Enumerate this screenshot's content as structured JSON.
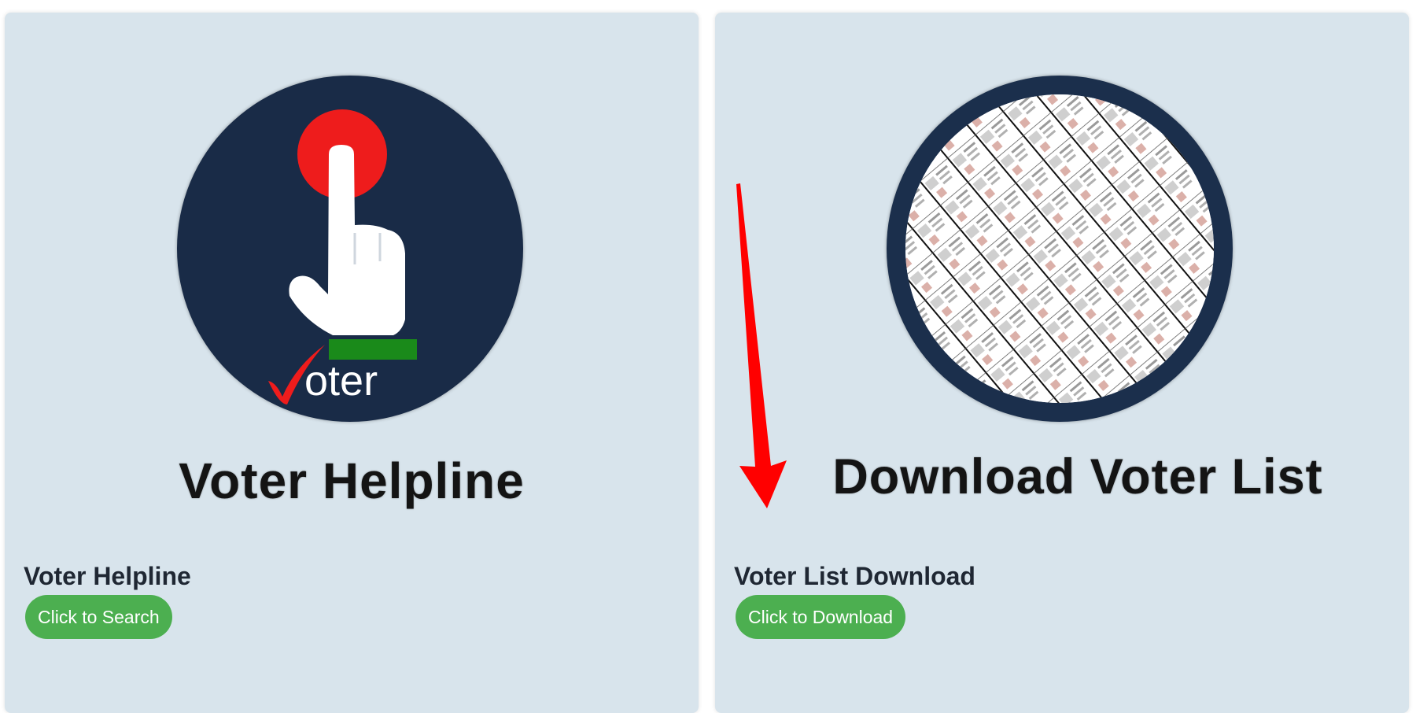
{
  "cards": [
    {
      "banner": "Voter Helpline",
      "logo_text": "oter",
      "title": "Voter Helpline",
      "button_label": "Click to Search"
    },
    {
      "banner": "Download Voter List",
      "title": "Voter List Download",
      "button_label": "Click to Download"
    }
  ],
  "colors": {
    "card_bg": "#d8e4ec",
    "button_bg": "#4caf50",
    "logo_circle": "#192b47",
    "logo_red": "#ee1c1c",
    "logo_green": "#1a8a1a",
    "annotation_arrow": "#ff0000"
  },
  "icons": [
    "tap-finger-icon",
    "checkmark-icon",
    "voter-list-document-icon",
    "annotation-arrow"
  ]
}
